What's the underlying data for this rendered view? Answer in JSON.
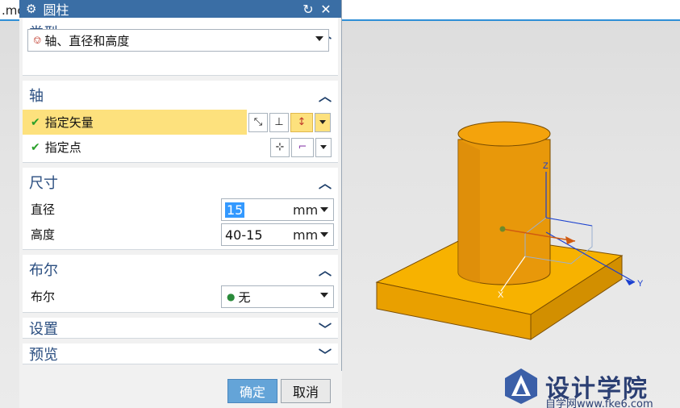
{
  "window": {
    "tab_fragment": ".mc"
  },
  "dialog": {
    "title": "圆柱",
    "groups": {
      "type": {
        "title": "类型",
        "select_value": "轴、直径和高度"
      },
      "axis": {
        "title": "轴",
        "specify_vector": "指定矢量",
        "specify_point": "指定点"
      },
      "dimensions": {
        "title": "尺寸",
        "diameter": {
          "label": "直径",
          "value": "15",
          "unit": "mm"
        },
        "height": {
          "label": "高度",
          "value": "40-15",
          "unit": "mm"
        }
      },
      "boolean": {
        "title": "布尔",
        "label": "布尔",
        "value": "无"
      },
      "settings": {
        "title": "设置"
      },
      "preview": {
        "title": "预览"
      }
    },
    "buttons": {
      "ok": "确定",
      "cancel": "取消"
    }
  },
  "viewport": {
    "axis_labels": {
      "z": "Z",
      "y": "Y",
      "x": "X"
    },
    "colors": {
      "solid": "#f5a500",
      "solid_dark": "#c98000",
      "axis": "#1a3fd0"
    }
  },
  "watermark": {
    "title": "设计学院",
    "subtitle": "自学网www.fke6.com"
  }
}
